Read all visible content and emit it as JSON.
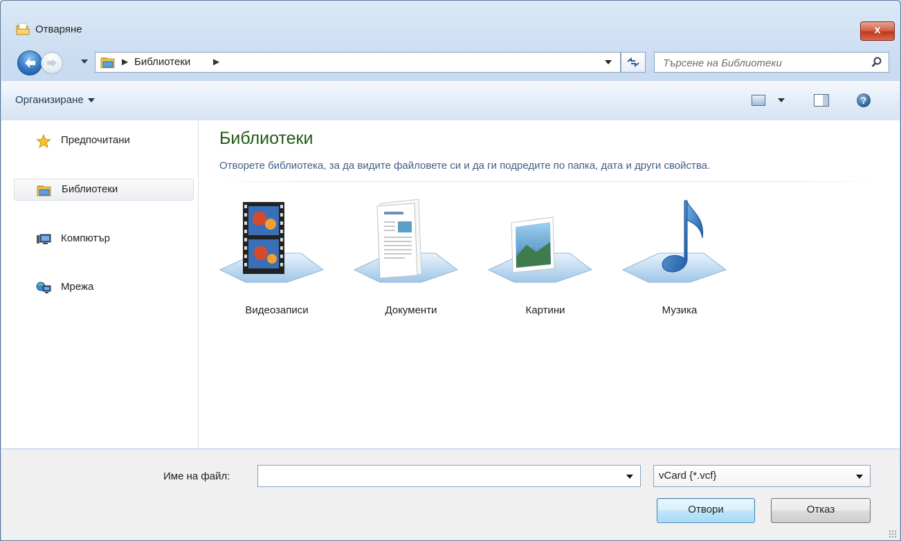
{
  "window": {
    "title": "Отваряне",
    "close_label": "x"
  },
  "navigation": {
    "breadcrumbs": [
      "Библиотеки"
    ],
    "search_placeholder": "Търсене на Библиотеки"
  },
  "toolbar": {
    "organize_label": "Организиране",
    "help_label": "?"
  },
  "nav_pane": {
    "items": [
      {
        "label": "Предпочитани",
        "icon": "star-icon"
      },
      {
        "label": "Библиотеки",
        "icon": "libraries-icon",
        "selected": true
      },
      {
        "label": "Компютър",
        "icon": "computer-icon"
      },
      {
        "label": "Мрежа",
        "icon": "network-icon"
      }
    ]
  },
  "content": {
    "title": "Библиотеки",
    "description": "Отворете библиотека, за да видите файловете си и да ги подредите по папка, дата и други свойства.",
    "libraries": [
      {
        "label": "Видеозаписи",
        "icon": "video-library-icon"
      },
      {
        "label": "Документи",
        "icon": "documents-library-icon"
      },
      {
        "label": "Картини",
        "icon": "pictures-library-icon"
      },
      {
        "label": "Музика",
        "icon": "music-library-icon"
      }
    ]
  },
  "footer": {
    "filename_label": "Име на файл:",
    "filename_value": "",
    "filetype_value": "vCard {*.vcf}",
    "open_button": "Отвори",
    "cancel_button": "Отказ"
  },
  "colors": {
    "title_green": "#1e5b12",
    "desc_blue": "#3e5f86",
    "toolbar_text": "#1e395b"
  }
}
